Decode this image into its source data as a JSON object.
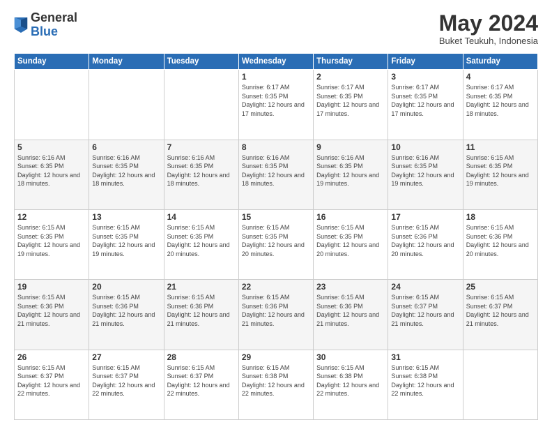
{
  "header": {
    "logo": {
      "line1": "General",
      "line2": "Blue"
    },
    "title": "May 2024",
    "location": "Buket Teukuh, Indonesia"
  },
  "days_of_week": [
    "Sunday",
    "Monday",
    "Tuesday",
    "Wednesday",
    "Thursday",
    "Friday",
    "Saturday"
  ],
  "weeks": [
    [
      {
        "day": "",
        "info": ""
      },
      {
        "day": "",
        "info": ""
      },
      {
        "day": "",
        "info": ""
      },
      {
        "day": "1",
        "info": "Sunrise: 6:17 AM\nSunset: 6:35 PM\nDaylight: 12 hours and 17 minutes."
      },
      {
        "day": "2",
        "info": "Sunrise: 6:17 AM\nSunset: 6:35 PM\nDaylight: 12 hours and 17 minutes."
      },
      {
        "day": "3",
        "info": "Sunrise: 6:17 AM\nSunset: 6:35 PM\nDaylight: 12 hours and 17 minutes."
      },
      {
        "day": "4",
        "info": "Sunrise: 6:17 AM\nSunset: 6:35 PM\nDaylight: 12 hours and 18 minutes."
      }
    ],
    [
      {
        "day": "5",
        "info": "Sunrise: 6:16 AM\nSunset: 6:35 PM\nDaylight: 12 hours and 18 minutes."
      },
      {
        "day": "6",
        "info": "Sunrise: 6:16 AM\nSunset: 6:35 PM\nDaylight: 12 hours and 18 minutes."
      },
      {
        "day": "7",
        "info": "Sunrise: 6:16 AM\nSunset: 6:35 PM\nDaylight: 12 hours and 18 minutes."
      },
      {
        "day": "8",
        "info": "Sunrise: 6:16 AM\nSunset: 6:35 PM\nDaylight: 12 hours and 18 minutes."
      },
      {
        "day": "9",
        "info": "Sunrise: 6:16 AM\nSunset: 6:35 PM\nDaylight: 12 hours and 19 minutes."
      },
      {
        "day": "10",
        "info": "Sunrise: 6:16 AM\nSunset: 6:35 PM\nDaylight: 12 hours and 19 minutes."
      },
      {
        "day": "11",
        "info": "Sunrise: 6:15 AM\nSunset: 6:35 PM\nDaylight: 12 hours and 19 minutes."
      }
    ],
    [
      {
        "day": "12",
        "info": "Sunrise: 6:15 AM\nSunset: 6:35 PM\nDaylight: 12 hours and 19 minutes."
      },
      {
        "day": "13",
        "info": "Sunrise: 6:15 AM\nSunset: 6:35 PM\nDaylight: 12 hours and 19 minutes."
      },
      {
        "day": "14",
        "info": "Sunrise: 6:15 AM\nSunset: 6:35 PM\nDaylight: 12 hours and 20 minutes."
      },
      {
        "day": "15",
        "info": "Sunrise: 6:15 AM\nSunset: 6:35 PM\nDaylight: 12 hours and 20 minutes."
      },
      {
        "day": "16",
        "info": "Sunrise: 6:15 AM\nSunset: 6:35 PM\nDaylight: 12 hours and 20 minutes."
      },
      {
        "day": "17",
        "info": "Sunrise: 6:15 AM\nSunset: 6:36 PM\nDaylight: 12 hours and 20 minutes."
      },
      {
        "day": "18",
        "info": "Sunrise: 6:15 AM\nSunset: 6:36 PM\nDaylight: 12 hours and 20 minutes."
      }
    ],
    [
      {
        "day": "19",
        "info": "Sunrise: 6:15 AM\nSunset: 6:36 PM\nDaylight: 12 hours and 21 minutes."
      },
      {
        "day": "20",
        "info": "Sunrise: 6:15 AM\nSunset: 6:36 PM\nDaylight: 12 hours and 21 minutes."
      },
      {
        "day": "21",
        "info": "Sunrise: 6:15 AM\nSunset: 6:36 PM\nDaylight: 12 hours and 21 minutes."
      },
      {
        "day": "22",
        "info": "Sunrise: 6:15 AM\nSunset: 6:36 PM\nDaylight: 12 hours and 21 minutes."
      },
      {
        "day": "23",
        "info": "Sunrise: 6:15 AM\nSunset: 6:36 PM\nDaylight: 12 hours and 21 minutes."
      },
      {
        "day": "24",
        "info": "Sunrise: 6:15 AM\nSunset: 6:37 PM\nDaylight: 12 hours and 21 minutes."
      },
      {
        "day": "25",
        "info": "Sunrise: 6:15 AM\nSunset: 6:37 PM\nDaylight: 12 hours and 21 minutes."
      }
    ],
    [
      {
        "day": "26",
        "info": "Sunrise: 6:15 AM\nSunset: 6:37 PM\nDaylight: 12 hours and 22 minutes."
      },
      {
        "day": "27",
        "info": "Sunrise: 6:15 AM\nSunset: 6:37 PM\nDaylight: 12 hours and 22 minutes."
      },
      {
        "day": "28",
        "info": "Sunrise: 6:15 AM\nSunset: 6:37 PM\nDaylight: 12 hours and 22 minutes."
      },
      {
        "day": "29",
        "info": "Sunrise: 6:15 AM\nSunset: 6:38 PM\nDaylight: 12 hours and 22 minutes."
      },
      {
        "day": "30",
        "info": "Sunrise: 6:15 AM\nSunset: 6:38 PM\nDaylight: 12 hours and 22 minutes."
      },
      {
        "day": "31",
        "info": "Sunrise: 6:15 AM\nSunset: 6:38 PM\nDaylight: 12 hours and 22 minutes."
      },
      {
        "day": "",
        "info": ""
      }
    ]
  ]
}
